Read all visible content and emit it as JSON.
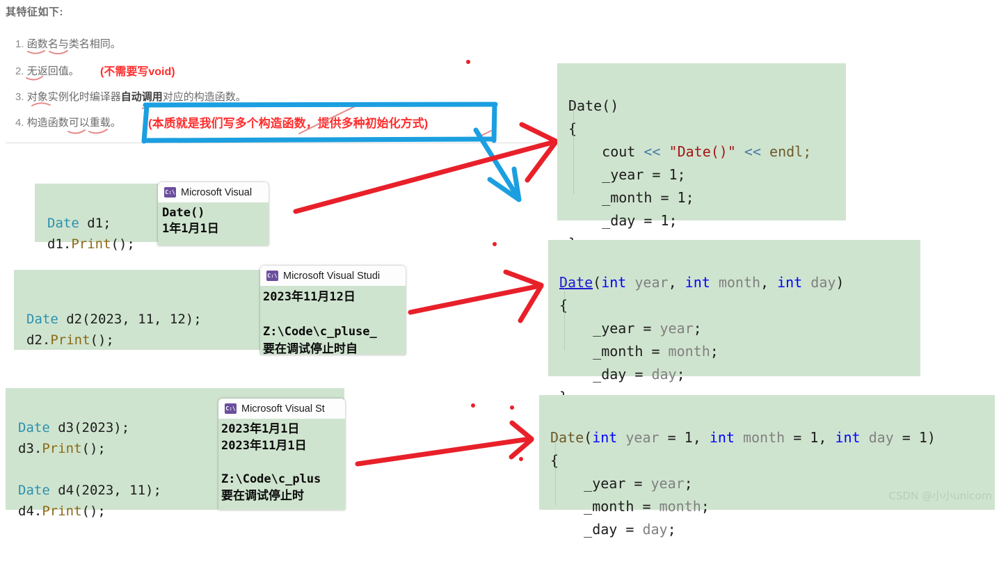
{
  "notes": {
    "heading": "其特征如下:",
    "items": [
      {
        "num": "1.",
        "text": "函数名与类名相同。"
      },
      {
        "num": "2.",
        "text": "无返回值。"
      },
      {
        "num": "3.",
        "pre": "对象实例化时编译器",
        "bold": "自动调用",
        "post": "对应的构造函数。"
      },
      {
        "num": "4.",
        "text": "构造函数可以重载。"
      }
    ],
    "annotations": {
      "void_note": "(不需要写void)",
      "overload_note": "(本质就是我们写多个构造函数，提供多种初始化方式)"
    }
  },
  "left_code": {
    "block1": {
      "lines": [
        {
          "type": "Date",
          "rest": " d1;"
        },
        {
          "var": "d1",
          "dot": ".",
          "fn": "Print",
          "rest": "();"
        }
      ]
    },
    "block2": {
      "lines": [
        {
          "type": "Date",
          "rest": " d2(2023, 11, 12);"
        },
        {
          "var": "d2",
          "dot": ".",
          "fn": "Print",
          "rest": "();"
        }
      ]
    },
    "block3": {
      "lines": [
        {
          "type": "Date",
          "rest": " d3(2023);"
        },
        {
          "var": "d3",
          "dot": ".",
          "fn": "Print",
          "rest": "();"
        },
        {
          "blank": ""
        },
        {
          "type": "Date",
          "rest": " d4(2023, 11);"
        },
        {
          "var": "d4",
          "dot": ".",
          "fn": "Print",
          "rest": "();"
        }
      ]
    }
  },
  "consoles": {
    "c1": {
      "title": "Microsoft Visual",
      "icon_label": "C:\\",
      "lines": [
        "Date()",
        "1年1月1日"
      ]
    },
    "c2": {
      "title": "Microsoft Visual Studi",
      "icon_label": "C:\\",
      "lines": [
        "2023年11月12日",
        "",
        "Z:\\Code\\c_pluse_",
        "要在调试停止时自"
      ]
    },
    "c3": {
      "title": "Microsoft Visual St",
      "icon_label": "C:\\",
      "lines": [
        "2023年1月1日",
        "2023年11月1日",
        "",
        "Z:\\Code\\c_plus",
        "要在调试停止时"
      ]
    }
  },
  "right_code": {
    "ctor_default": {
      "signature": "Date()",
      "open": "{",
      "body": [
        {
          "parts": [
            {
              "t": "cout ",
              "c": "plain"
            },
            {
              "t": "<<",
              "c": "op"
            },
            {
              "t": " ",
              "c": "plain"
            },
            {
              "t": "\"Date()\"",
              "c": "str"
            },
            {
              "t": " ",
              "c": "plain"
            },
            {
              "t": "<<",
              "c": "op"
            },
            {
              "t": " endl;",
              "c": "brown"
            }
          ]
        },
        {
          "parts": [
            {
              "t": "_year = 1;",
              "c": "plain"
            }
          ]
        },
        {
          "parts": [
            {
              "t": "_month = 1;",
              "c": "plain"
            }
          ]
        },
        {
          "parts": [
            {
              "t": "_day = 1;",
              "c": "plain"
            }
          ]
        }
      ],
      "close": "}"
    },
    "ctor_params": {
      "sig_parts": [
        {
          "t": "Date",
          "c": "link"
        },
        {
          "t": "(",
          "c": "plain"
        },
        {
          "t": "int",
          "c": "kw"
        },
        {
          "t": " year",
          "c": "param"
        },
        {
          "t": ", ",
          "c": "plain"
        },
        {
          "t": "int",
          "c": "kw"
        },
        {
          "t": " month",
          "c": "param"
        },
        {
          "t": ", ",
          "c": "plain"
        },
        {
          "t": "int",
          "c": "kw"
        },
        {
          "t": " day",
          "c": "param"
        },
        {
          "t": ")",
          "c": "plain"
        }
      ],
      "open": "{",
      "body": [
        {
          "lhs": "_year = ",
          "rhs": "year",
          "end": ";"
        },
        {
          "lhs": "_month = ",
          "rhs": "month",
          "end": ";"
        },
        {
          "lhs": "_day = ",
          "rhs": "day",
          "end": ";"
        }
      ],
      "close": "}"
    },
    "ctor_defaults": {
      "sig_parts": [
        {
          "t": "Date",
          "c": "brown"
        },
        {
          "t": "(",
          "c": "plain"
        },
        {
          "t": "int",
          "c": "kw"
        },
        {
          "t": " year",
          "c": "param"
        },
        {
          "t": " = 1, ",
          "c": "plain"
        },
        {
          "t": "int",
          "c": "kw"
        },
        {
          "t": " month",
          "c": "param"
        },
        {
          "t": " = 1, ",
          "c": "plain"
        },
        {
          "t": "int",
          "c": "kw"
        },
        {
          "t": " day",
          "c": "param"
        },
        {
          "t": " = 1)",
          "c": "plain"
        }
      ],
      "open": "{",
      "body": [
        {
          "lhs": "_year = ",
          "rhs": "year",
          "end": ";"
        },
        {
          "lhs": "_month = ",
          "rhs": "month",
          "end": ";"
        },
        {
          "lhs": "_day = ",
          "rhs": "day",
          "end": ";"
        }
      ]
    }
  },
  "watermark": "CSDN @小小unicorn",
  "colors": {
    "code_bg": "#cfe4cf",
    "red_ink": "#e8202a",
    "blue_ink": "#1b9fe0",
    "note_text": "#6b6b6b",
    "annotation_red": "#ff2d2d"
  }
}
